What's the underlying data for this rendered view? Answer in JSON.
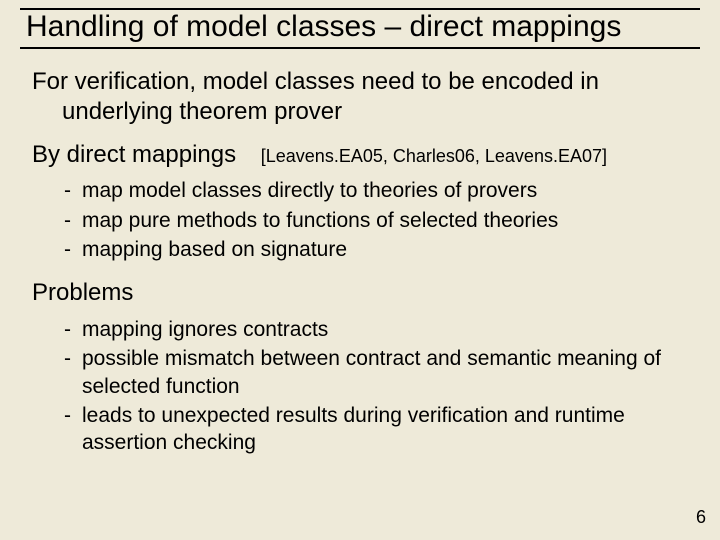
{
  "title": "Handling of model classes – direct mappings",
  "intro_line1": "For verification, model classes need to be encoded in",
  "intro_line2": "underlying theorem prover",
  "section1": {
    "heading": "By direct mappings",
    "citation": "[Leavens.EA05, Charles06, Leavens.EA07]",
    "bullets": [
      "map model classes directly to theories of provers",
      "map pure methods to functions of selected theories",
      "mapping based on signature"
    ]
  },
  "section2": {
    "heading": "Problems",
    "bullets": [
      "mapping ignores contracts",
      "possible mismatch between contract and semantic meaning of selected function",
      "leads to unexpected results during verification and runtime assertion checking"
    ]
  },
  "page_number": "6"
}
